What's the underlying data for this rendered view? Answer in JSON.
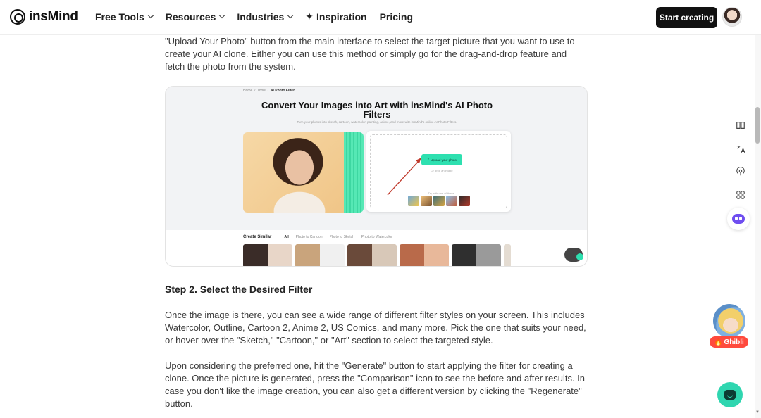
{
  "header": {
    "brand": "insMind",
    "nav": [
      "Free Tools",
      "Resources",
      "Industries",
      "Inspiration",
      "Pricing"
    ],
    "cta": "Start creating"
  },
  "article": {
    "para_intro": "\"Upload Your Photo\" button from the main interface to select the target picture that you want to use to create your AI clone. Either you can use this method or simply go for the drag-and-drop feature and fetch the photo from the system.",
    "step_heading": "Step 2. Select the Desired Filter",
    "para_step2a": "Once the image is there, you can see a wide range of different filter styles on your screen. This includes Watercolor, Outline, Cartoon 2, Anime 2, US Comics, and many more. Pick the one that suits your need, or hover over the \"Sketch,\" \"Cartoon,\" or \"Art\" section to select the targeted style.",
    "para_step2b": "Upon considering the preferred one, hit the \"Generate\" button to start applying the filter for creating a clone. Once the picture is generated, press the \"Comparison\" icon to see the before and after results. In case you don't like the image creation, you can also get a different version by clicking the \"Regenerate\" button."
  },
  "figure": {
    "breadcrumb": [
      "Home",
      "Tools",
      "AI Photo Filter"
    ],
    "title": "Convert Your Images into Art with insMind's AI Photo Filters",
    "subtitle": "Turn your photos into sketch, cartoon, watercolor, painting, anime, and more with insMind's online AI Photo Filters.",
    "upload_button": "Upload your photo",
    "drop_text": "Or drop an image",
    "try_text": "Try with one of these",
    "create_similar": "Create Similar",
    "tabs": [
      "All",
      "Photo to Cartoon",
      "Photo to Sketch",
      "Photo to Watercolor"
    ],
    "next_arrow": "›"
  },
  "rail": {
    "icons": [
      "book-icon",
      "translate-icon",
      "podcast-icon",
      "grid-icon",
      "assistant-robot-icon"
    ]
  },
  "badges": {
    "ghibli": "Ghibli"
  },
  "colors": {
    "accent": "#2ee0b0",
    "cta_bg": "#111111",
    "ghibli_badge": "#ff4a3d"
  }
}
